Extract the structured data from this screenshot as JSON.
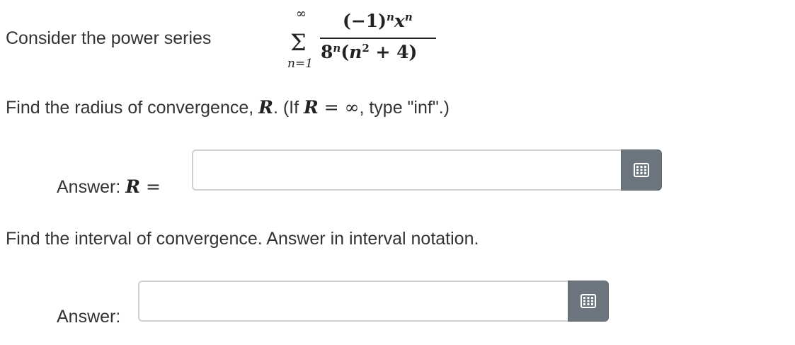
{
  "question": {
    "intro": "Consider the power series",
    "series": {
      "sum_upper": "∞",
      "sum_symbol": "Σ",
      "sum_lower": "n=1",
      "numerator_base": "(−1)",
      "numerator_exp1": "n",
      "numerator_var": "x",
      "numerator_exp2": "n",
      "denominator_base": "8",
      "denominator_exp1": "n",
      "denominator_open": "(",
      "denominator_var": "n",
      "denominator_exp2": "2",
      "denominator_rest": " + 4)"
    },
    "radius_prompt_a": "Find the radius of convergence, ",
    "radius_prompt_R1": "R",
    "radius_prompt_b": ". (If ",
    "radius_prompt_R2": "R",
    "radius_prompt_c": " = ∞",
    "radius_prompt_d": ", type \"inf\".)",
    "interval_prompt": "Find the interval of convergence. Answer in interval notation."
  },
  "answer1": {
    "label": "Answer: ",
    "label_var": "R",
    "label_eq": " =",
    "value": "",
    "placeholder": ""
  },
  "answer2": {
    "label": "Answer:",
    "value": "",
    "placeholder": ""
  },
  "icons": {
    "keypad": "keypad-icon"
  },
  "colors": {
    "text": "#333333",
    "button_bg": "#6c757d",
    "input_border": "#d0d0d0"
  }
}
